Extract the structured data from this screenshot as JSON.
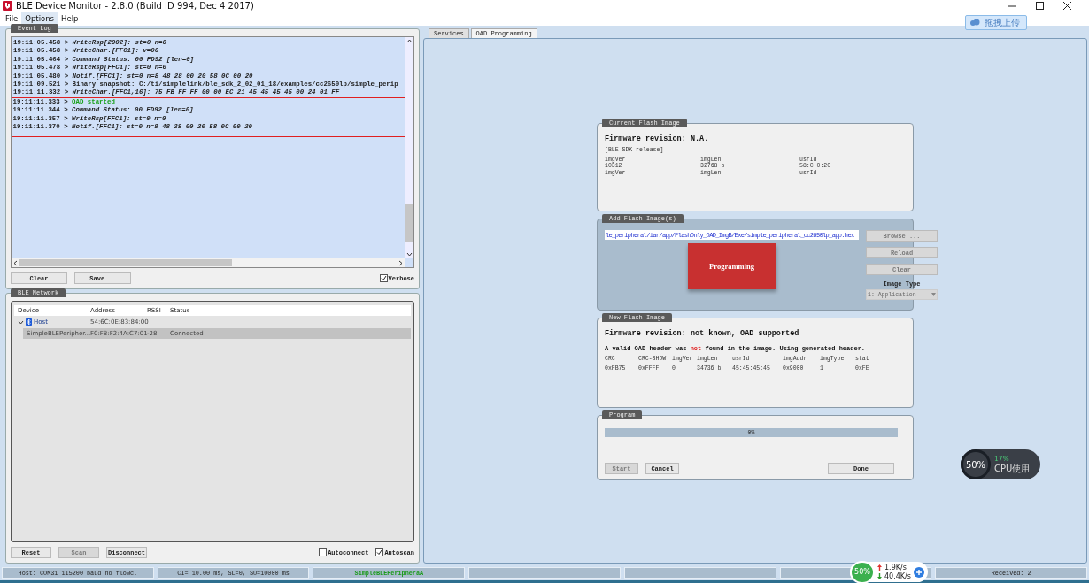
{
  "window": {
    "title": "BLE Device Monitor - 2.8.0 (Build ID 994, Dec  4 2017)"
  },
  "menu": [
    {
      "label": "File",
      "selected": false
    },
    {
      "label": "Options",
      "selected": true
    },
    {
      "label": "Help",
      "selected": false
    }
  ],
  "event_log": {
    "title": "Event Log",
    "lines": [
      {
        "time": "19:11:05.458 >",
        "message": "WriteRsp[2902]: st=0 n=0",
        "kind": "event"
      },
      {
        "time": "19:11:05.458 >",
        "message": "WriteChar.[FFC1]: v=00",
        "kind": "event"
      },
      {
        "time": "19:11:05.464 >",
        "message": "Command Status: 00 FD92 [len=0]",
        "kind": "event"
      },
      {
        "time": "19:11:05.478 >",
        "message": "WriteRsp[FFC1]: st=0 n=0",
        "kind": "event"
      },
      {
        "time": "19:11:05.480 >",
        "message": "Notif.[FFC1]: st=0 n=8 48 28 00 20 58 0C 00 20",
        "kind": "event"
      },
      {
        "time": "19:11:09.521 >",
        "message": "Binary snapshot: C:/ti/simplelink/ble_sdk_2_02_01_18/examples/cc2650lp/simple_perip",
        "kind": "info"
      },
      {
        "time": "19:11:11.332 >",
        "message": "WriteChar.[FFC1,16]: 75 FB FF FF 00 00 EC 21 45 45 45 45 00 24 01 FF",
        "kind": "event"
      }
    ],
    "highlighted_lines": [
      {
        "time": "19:11:11.333 >",
        "message": "OAD started",
        "kind": "success"
      },
      {
        "time": "19:11:11.344 >",
        "message": "Command Status: 00 FD92 [len=0]",
        "kind": "event"
      },
      {
        "time": "19:11:11.357 >",
        "message": "WriteRsp[FFC1]: st=0 n=0",
        "kind": "event"
      },
      {
        "time": "19:11:11.370 >",
        "message": "Notif.[FFC1]: st=0 n=8 48 28 00 20 58 0C 00 20",
        "kind": "event"
      }
    ],
    "buttons": [
      "Clear",
      "Save..."
    ],
    "verbose": {
      "label": "Verbose",
      "checked": true
    }
  },
  "ble_network": {
    "title": "BLE Network",
    "columns": [
      "Device",
      "Address",
      "RSSI",
      "Status"
    ],
    "rows": [
      {
        "cells": [
          "Host",
          "54:6C:0E:83:84:00"
        ],
        "expanded": true,
        "selected": false,
        "children": [
          {
            "cells": [
              "SimpleBLEPeripher...",
              "F0:F8:F2:4A:C7:01",
              "-28",
              "Connected"
            ],
            "selected": true
          }
        ]
      }
    ],
    "buttons": [
      {
        "label": "Reset",
        "disabled": false
      },
      {
        "label": "Scan",
        "disabled": true
      },
      {
        "label": "Disconnect",
        "disabled": false
      }
    ],
    "options": [
      {
        "label": "Autoconnect",
        "checked": false
      },
      {
        "label": "Autoscan",
        "checked": true
      }
    ]
  },
  "tabs": [
    {
      "label": "Services",
      "selected": false
    },
    {
      "label": "OAD Programming",
      "selected": true
    }
  ],
  "current_flash_image": {
    "title": "Current Flash Image",
    "firmware": "Firmware revision: N.A.",
    "note": "[BLE SDK release]",
    "rows": [
      [
        {
          "label": "imgVer",
          "value": "10312"
        },
        {
          "label": "imgLen",
          "value": "32768 b"
        },
        {
          "label": "usrId",
          "value": "58:C:0:20"
        }
      ],
      [
        {
          "label": "imgVer"
        },
        {
          "label": "imgLen"
        },
        {
          "label": "usrId"
        }
      ]
    ]
  },
  "add_flash_image": {
    "title": "Add Flash Image(s)",
    "path": "le_peripheral/iar/app/FlashOnly_OAD_ImgB/Exe/simple_peripheral_cc2650lp_app.hex",
    "busy_label": "Programming",
    "buttons": [
      {
        "label": "Browse ...",
        "disabled": true
      },
      {
        "label": "Reload",
        "disabled": true
      },
      {
        "label": "Clear",
        "disabled": true
      }
    ],
    "image_type": {
      "label": "Image Type",
      "value": "1: Application",
      "disabled": true
    }
  },
  "new_flash_image": {
    "title": "New Flash Image",
    "firmware": "Firmware revision: not known, OAD supported",
    "message": [
      {
        "text": "A valid OAD header was ",
        "kind": "normal"
      },
      {
        "text": "not",
        "kind": "alert"
      },
      {
        "text": " found in the image. Using generated header.",
        "kind": "normal"
      }
    ],
    "columns": [
      "CRC",
      "CRC-SHDW",
      "imgVer",
      "imgLen",
      "usrId",
      "imgAddr",
      "imgType",
      "stat"
    ],
    "values": [
      "0xFB75",
      "0xFFFF",
      "0",
      "34736 b",
      "45:45:45:45",
      "0x9000",
      "1",
      "0xFE"
    ]
  },
  "program": {
    "title": "Program",
    "level": 0,
    "reading": "0%",
    "buttons": [
      {
        "label": "Start",
        "disabled": true
      },
      {
        "label": "Cancel",
        "disabled": false
      },
      {
        "label": "Done",
        "disabled": false
      }
    ]
  },
  "status_bar": [
    {
      "text": "Host: COM31 115200 baud no flowc.",
      "kind": "normal"
    },
    {
      "text": "CI= 10.00 ms, SL=0, SU=10000 ms",
      "kind": "normal"
    },
    {
      "text": "SimpleBLEPeripheraA",
      "kind": "device"
    },
    {
      "kind": "empty"
    },
    {
      "kind": "empty"
    },
    {
      "kind": "empty"
    },
    {
      "text": "Received: 2",
      "kind": "normal"
    }
  ],
  "upload_widget": {
    "label": "拖拽上传"
  },
  "cpu_widget": {
    "load": "50%",
    "cpu": "17%",
    "label": "CPU使用"
  },
  "net_widget": {
    "load": "50%",
    "up": "1.9K/s",
    "down": "40.4K/s"
  }
}
